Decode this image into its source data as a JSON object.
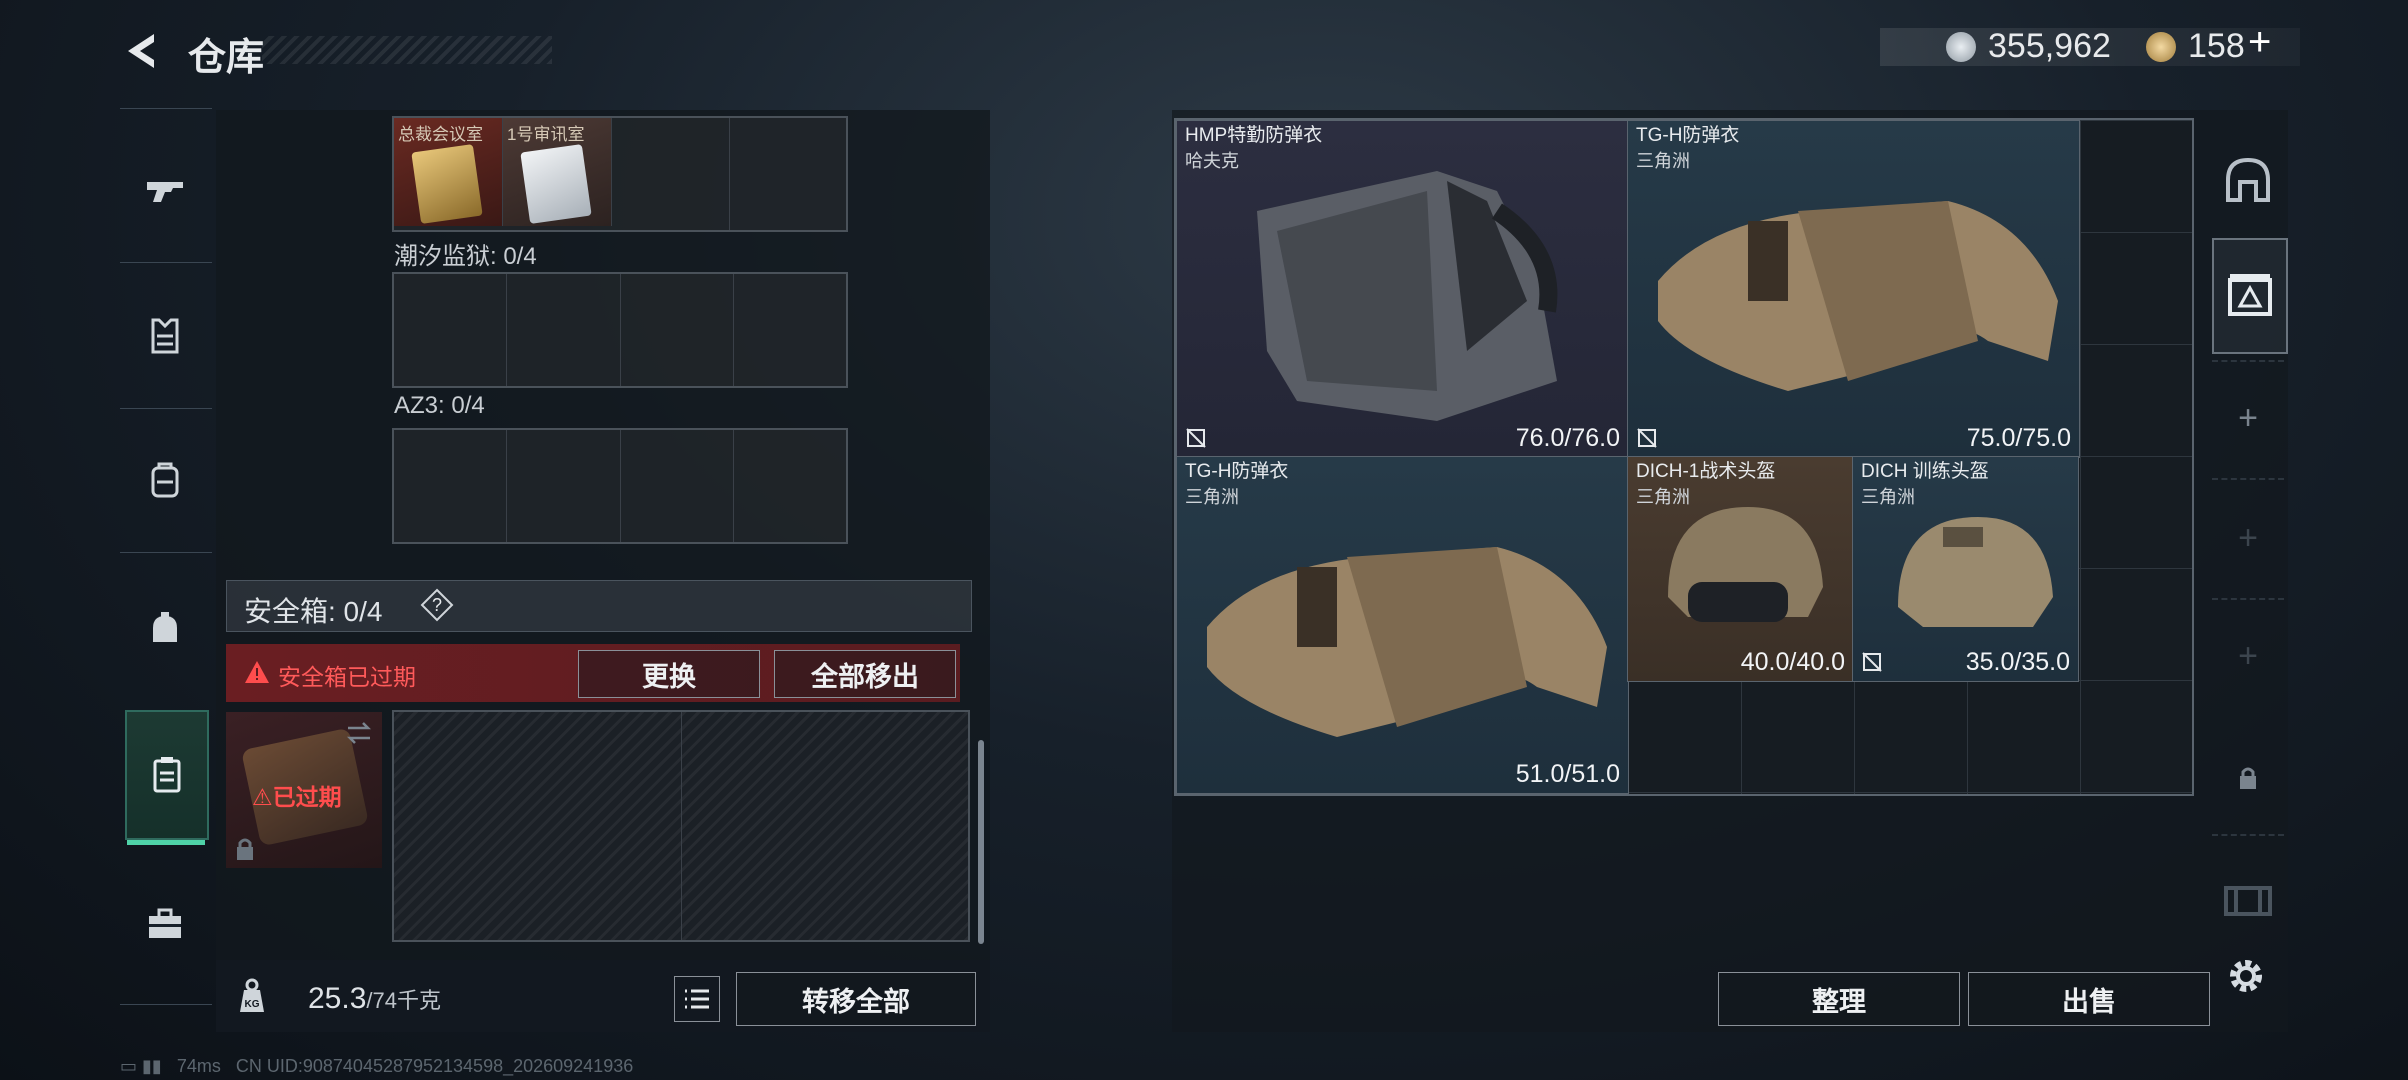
{
  "header": {
    "title": "仓库",
    "currency_silver": "355,962",
    "currency_gold": "158",
    "add_label": "+"
  },
  "containers": {
    "top_row_cards": [
      {
        "label": "总裁会议室"
      },
      {
        "label": "1号审讯室"
      }
    ],
    "section1_label": "潮汐监狱: 0/4",
    "section2_label": "AZ3: 0/4"
  },
  "safebox": {
    "title": "安全箱:  0/4",
    "help": "?",
    "warning": "安全箱已过期",
    "replace_label": "更换",
    "move_all_out_label": "全部移出",
    "expired_badge": "已过期"
  },
  "footer_left": {
    "weight_value": "25.3",
    "weight_cap": "/74千克",
    "transfer_all_label": "转移全部"
  },
  "stash_items": [
    {
      "name": "HMP特勤防弹衣",
      "source": "哈夫克",
      "durability": "76.0/76.0",
      "rarity": "purple"
    },
    {
      "name": "TG-H防弹衣",
      "source": "三角洲",
      "durability": "75.0/75.0",
      "rarity": "blue"
    },
    {
      "name": "TG-H防弹衣",
      "source": "三角洲",
      "durability": "51.0/51.0",
      "rarity": "blue"
    },
    {
      "name": "DICH-1战术头盔",
      "source": "三角洲",
      "durability": "40.0/40.0",
      "rarity": "brown"
    },
    {
      "name": "DICH 训练头盔",
      "source": "三角洲",
      "durability": "35.0/35.0",
      "rarity": "blue"
    }
  ],
  "right_nav": {
    "plus": "+"
  },
  "stash_footer": {
    "sort_label": "整理",
    "sell_label": "出售"
  },
  "status": {
    "ping": "74ms",
    "uid": "CN UID:9087404528795213459​8_202609241936"
  },
  "colors": {
    "accent_green": "#4fd3a8",
    "warning_red": "#ff5a5a",
    "rarity_purple": "#2c2e40",
    "rarity_blue": "#263a48",
    "rarity_brown": "#4a3c30"
  }
}
